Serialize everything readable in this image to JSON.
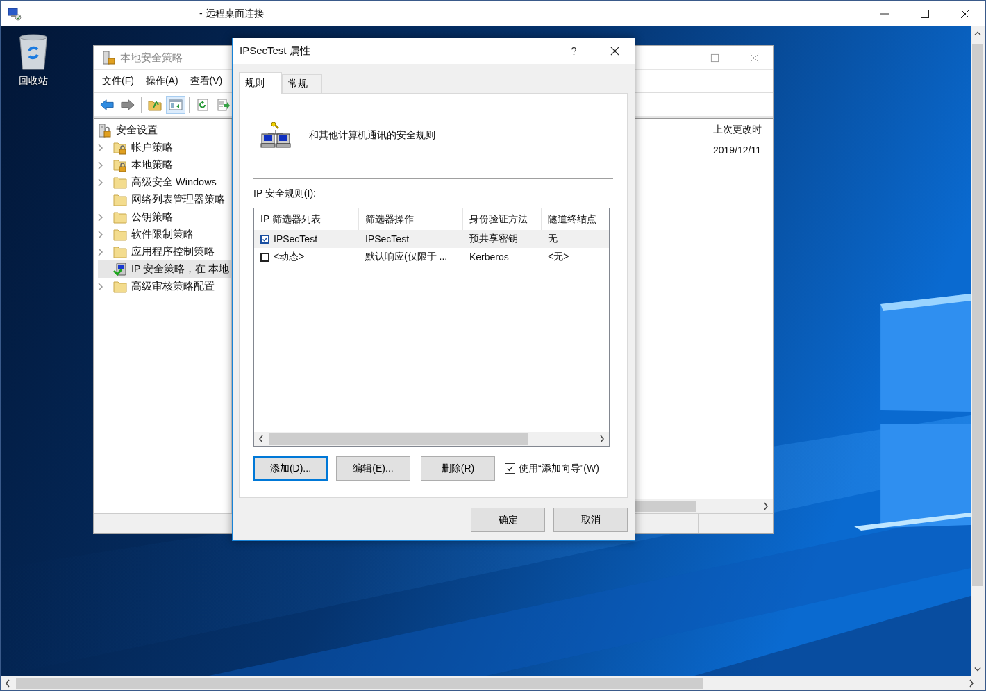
{
  "remote_window": {
    "title": "- 远程桌面连接"
  },
  "desktop_icons": [
    {
      "label": "回收站"
    }
  ],
  "mmc_window": {
    "title": "本地安全策略",
    "menu": [
      "文件(F)",
      "操作(A)",
      "查看(V)"
    ],
    "toolbar": [
      {
        "kind": "back",
        "pressed": false
      },
      {
        "kind": "forward",
        "pressed": false
      },
      {
        "kind": "up",
        "pressed": false
      },
      {
        "kind": "console-tree",
        "pressed": true
      },
      {
        "kind": "refresh",
        "pressed": false
      },
      {
        "kind": "export",
        "pressed": false
      }
    ],
    "tree": {
      "label": "安全设置",
      "kind": "root",
      "selected": false,
      "children": [
        {
          "label": "帐户策略",
          "kind": "locked-folder",
          "expandable": true,
          "selected": false
        },
        {
          "label": "本地策略",
          "kind": "locked-folder",
          "expandable": true,
          "selected": false
        },
        {
          "label": "高级安全 Windows",
          "kind": "folder",
          "expandable": true,
          "selected": false
        },
        {
          "label": "网络列表管理器策略",
          "kind": "folder",
          "expandable": false,
          "selected": false
        },
        {
          "label": "公钥策略",
          "kind": "folder",
          "expandable": true,
          "selected": false
        },
        {
          "label": "软件限制策略",
          "kind": "folder",
          "expandable": true,
          "selected": false
        },
        {
          "label": "应用程序控制策略",
          "kind": "folder",
          "expandable": true,
          "selected": false
        },
        {
          "label": "IP 安全策略，在 本地",
          "kind": "ip-security",
          "expandable": false,
          "selected": true
        },
        {
          "label": "高级审核策略配置",
          "kind": "folder",
          "expandable": true,
          "selected": false
        }
      ]
    },
    "list_header": "上次更改时",
    "list_rows": [
      "2019/12/11"
    ]
  },
  "dialog": {
    "title": "IPSecTest 属性",
    "tabs": [
      {
        "label": "规则",
        "selected": true
      },
      {
        "label": "常规",
        "selected": false
      }
    ],
    "description": "和其他计算机通讯的安全规则",
    "rules_label": "IP 安全规则(I):",
    "table": {
      "columns": [
        "IP 筛选器列表",
        "筛选器操作",
        "身份验证方法",
        "隧道终结点"
      ],
      "rows": [
        {
          "checked": true,
          "selected": true,
          "cells": [
            "IPSecTest",
            "IPSecTest",
            "预共享密钥",
            "无"
          ]
        },
        {
          "checked": false,
          "selected": false,
          "cells": [
            "<动态>",
            "默认响应(仅限于 ...",
            "Kerberos",
            "<无>"
          ]
        }
      ]
    },
    "buttons": [
      {
        "label": "添加(D)...",
        "focused": true
      },
      {
        "label": "编辑(E)...",
        "focused": false
      },
      {
        "label": "删除(R)",
        "focused": false
      }
    ],
    "wizard": {
      "label": "使用“添加向导”(W)",
      "checked": true
    },
    "footer_buttons": [
      "确定",
      "取消"
    ]
  }
}
